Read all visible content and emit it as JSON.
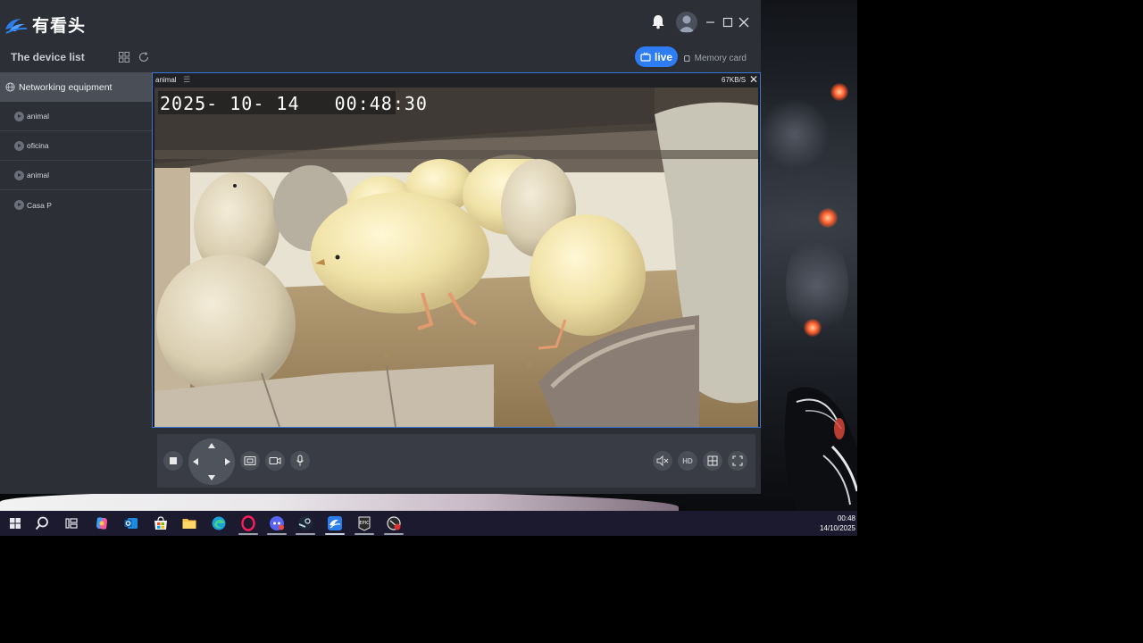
{
  "app": {
    "logo_text": "有看头"
  },
  "subbar": {
    "device_list_title": "The device list",
    "live_label": "live",
    "memory_label": "Memory card"
  },
  "sidebar": {
    "group_label": "Networking equipment",
    "items": [
      {
        "label": "animal"
      },
      {
        "label": "oficina"
      },
      {
        "label": "animal"
      },
      {
        "label": "Casa P"
      }
    ]
  },
  "video": {
    "channel_name": "animal",
    "speed": "67KB/S",
    "osd_timestamp": "2025- 10- 14   00:48:30"
  },
  "controls": {
    "hd_label": "HD"
  },
  "taskbar": {
    "time": "00:48",
    "date": "14/10/2025"
  },
  "colors": {
    "accent": "#2f7df4",
    "window_bg": "#2c2f36",
    "selected_bg": "#4a4e57",
    "video_border": "#3a76d6"
  }
}
